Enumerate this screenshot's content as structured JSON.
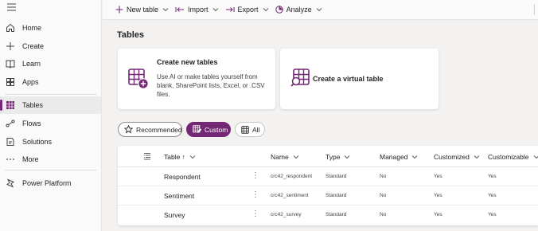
{
  "sidebar": {
    "items": [
      {
        "label": "Home",
        "icon": "home-icon"
      },
      {
        "label": "Create",
        "icon": "plus-icon"
      },
      {
        "label": "Learn",
        "icon": "book-icon"
      },
      {
        "label": "Apps",
        "icon": "apps-icon"
      },
      {
        "label": "Tables",
        "icon": "table-icon",
        "active": true
      },
      {
        "label": "Flows",
        "icon": "flow-icon"
      },
      {
        "label": "Solutions",
        "icon": "solutions-icon"
      },
      {
        "label": "More",
        "icon": "more-icon"
      },
      {
        "label": "Power Platform",
        "icon": "power-platform-icon"
      }
    ]
  },
  "toolbar": {
    "new_table": "New table",
    "import": "Import",
    "export": "Export",
    "analyze": "Analyze"
  },
  "main": {
    "title": "Tables",
    "cards": {
      "create": {
        "title": "Create new tables",
        "description": "Use AI or make tables yourself from blank, SharePoint lists, Excel, or .CSV files."
      },
      "virtual": {
        "title": "Create a virtual table"
      }
    },
    "filters": {
      "recommended": "Recommended",
      "custom": "Custom",
      "all": "All"
    },
    "table": {
      "headers": {
        "table": "Table ↑",
        "name": "Name",
        "type": "Type",
        "managed": "Managed",
        "customized": "Customized",
        "customizable": "Customizable"
      },
      "rows": [
        {
          "table": "Respondent",
          "name": "crc42_respondent",
          "type": "Standard",
          "managed": "No",
          "customized": "Yes",
          "customizable": "Yes"
        },
        {
          "table": "Sentiment",
          "name": "crc42_sentiment",
          "type": "Standard",
          "managed": "No",
          "customized": "Yes",
          "customizable": "Yes"
        },
        {
          "table": "Survey",
          "name": "crc42_survey",
          "type": "Standard",
          "managed": "No",
          "customized": "Yes",
          "customizable": "Yes"
        }
      ]
    }
  },
  "colors": {
    "accent": "#742774",
    "background": "#f3f2f1"
  }
}
